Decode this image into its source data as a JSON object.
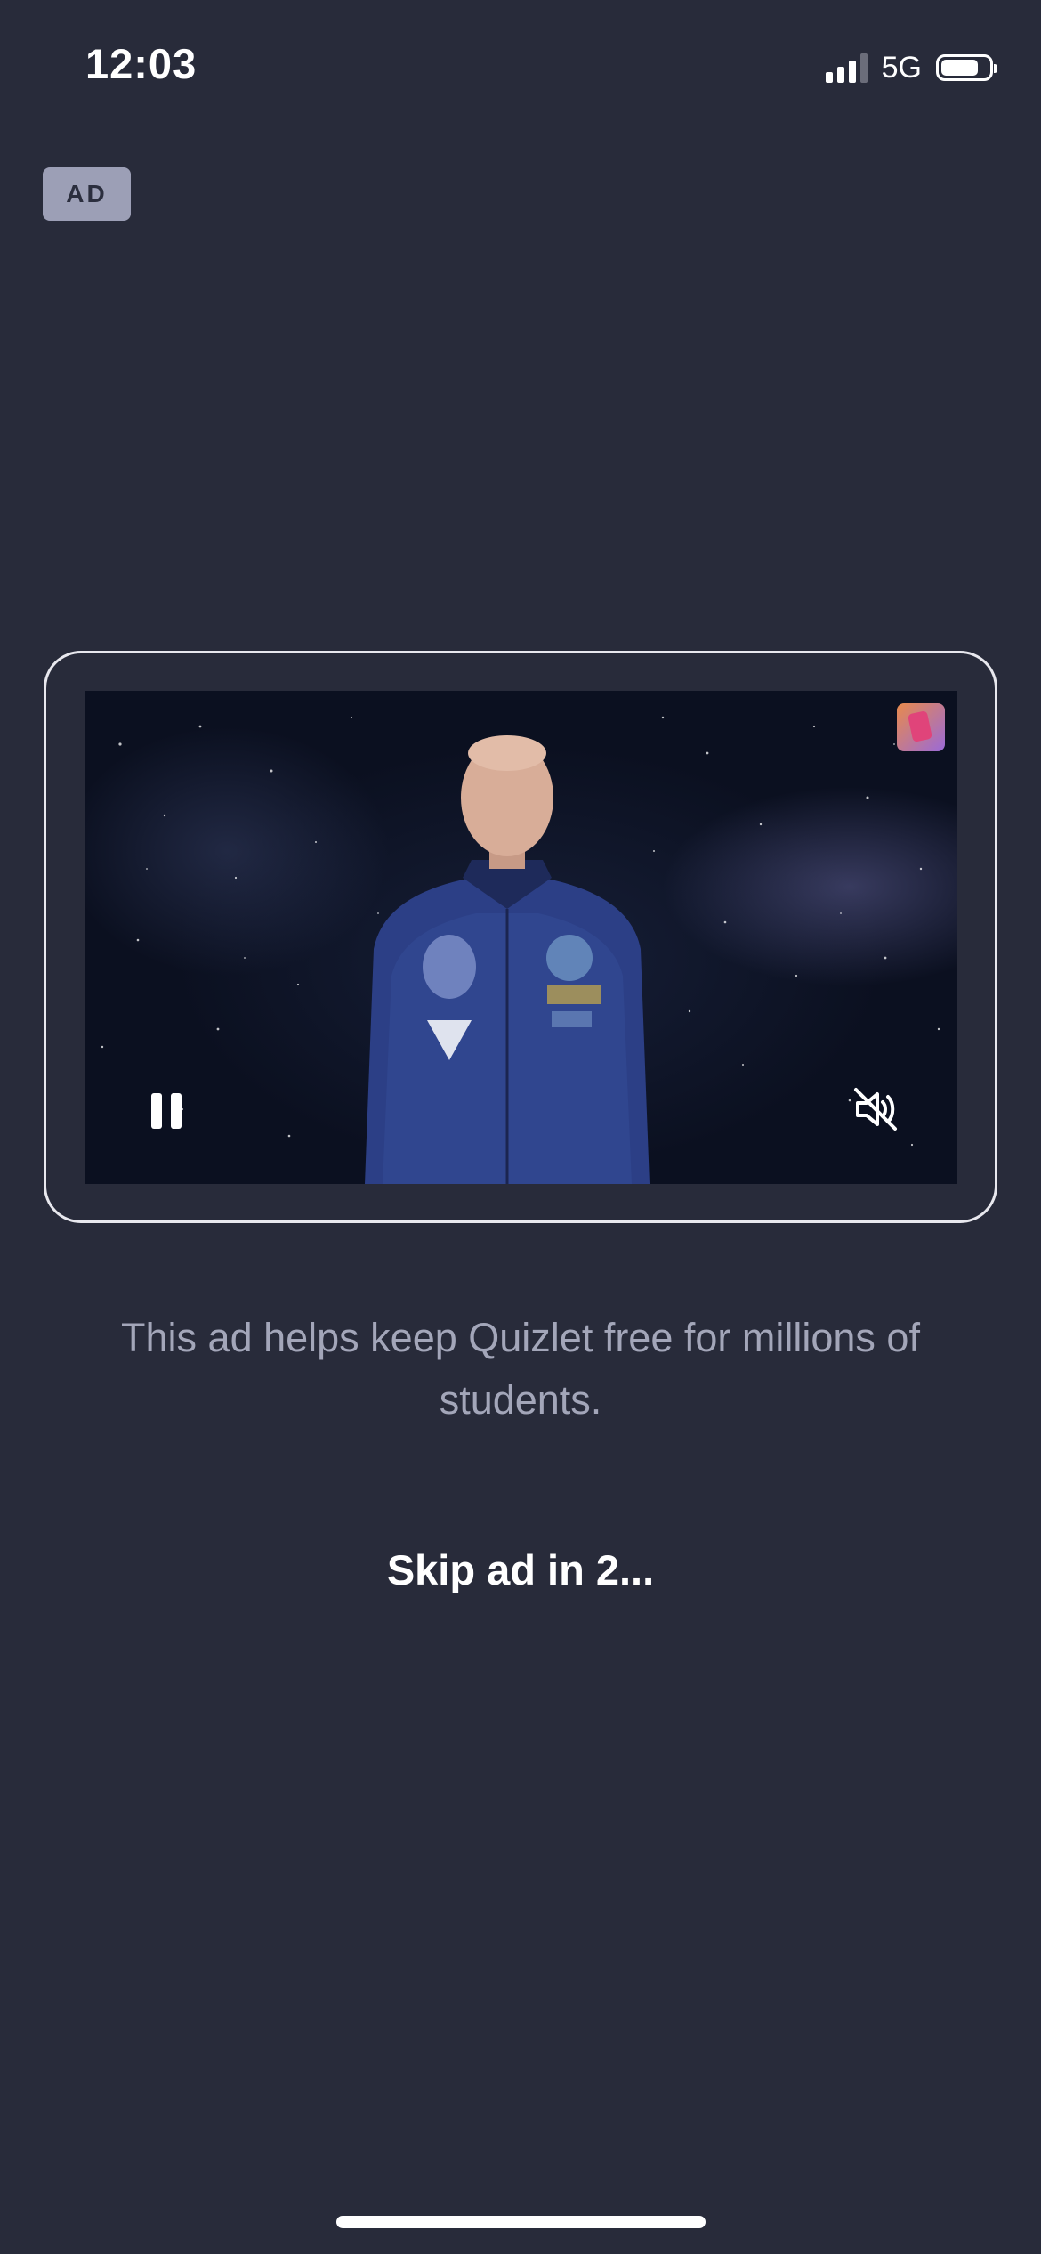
{
  "status_bar": {
    "time": "12:03",
    "network": "5G",
    "signal_bars_filled": 3,
    "signal_bars_total": 4
  },
  "ad_badge": {
    "label": "AD"
  },
  "video": {
    "state": "playing",
    "muted": true,
    "controls": {
      "pause_icon": "pause-icon",
      "mute_icon": "speaker-muted-icon"
    }
  },
  "caption": {
    "text": "This ad helps keep Quizlet free for millions of students."
  },
  "skip": {
    "label": "Skip ad in 2..."
  },
  "colors": {
    "background": "#282b3a",
    "badge": "#9c9fb6",
    "caption": "#a3a6b9"
  }
}
